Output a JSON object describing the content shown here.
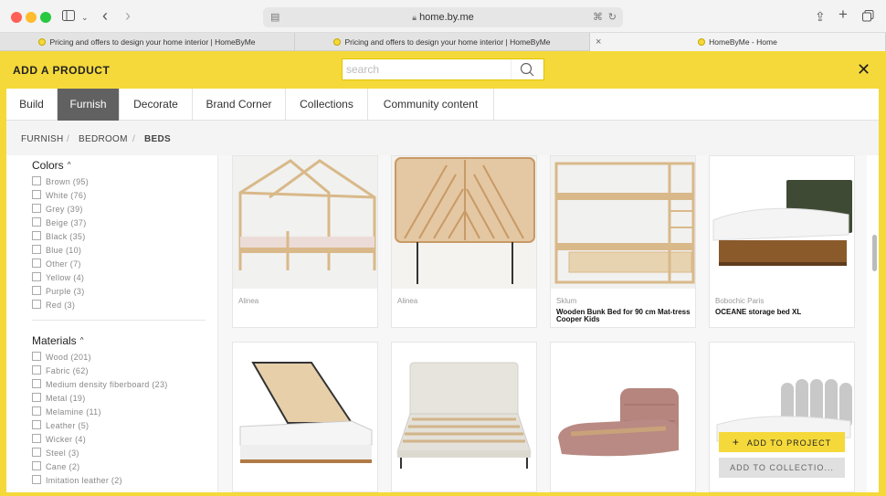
{
  "browser": {
    "url": "home.by.me",
    "tabs": [
      {
        "title": "Pricing and offers to design your home interior | HomeByMe"
      },
      {
        "title": "Pricing and offers to design your home interior | HomeByMe"
      },
      {
        "title": "HomeByMe - Home"
      }
    ]
  },
  "modal": {
    "title": "ADD A PRODUCT",
    "search_placeholder": "search"
  },
  "nav": {
    "tabs": [
      "Build",
      "Furnish",
      "Decorate",
      "Brand Corner",
      "Collections",
      "Community content"
    ],
    "active": "Furnish"
  },
  "breadcrumb": [
    "FURNISH",
    "BEDROOM",
    "BEDS"
  ],
  "filters": {
    "colors": {
      "title": "Colors",
      "options": [
        "Brown (95)",
        "White (76)",
        "Grey (39)",
        "Beige (37)",
        "Black (35)",
        "Blue (10)",
        "Other (7)",
        "Yellow (4)",
        "Purple (3)",
        "Red (3)"
      ]
    },
    "materials": {
      "title": "Materials",
      "options": [
        "Wood (201)",
        "Fabric (62)",
        "Medium density fiberboard (23)",
        "Metal (19)",
        "Melamine (11)",
        "Leather (5)",
        "Wicker (4)",
        "Steel (3)",
        "Cane (2)",
        "Imitation leather (2)"
      ]
    }
  },
  "products": [
    {
      "brand": "Alinea",
      "name": "",
      "icon": "house-bed-icon"
    },
    {
      "brand": "Alinea",
      "name": "",
      "icon": "headboard-icon"
    },
    {
      "brand": "Sklum",
      "name": "Wooden Bunk Bed for 90 cm Mat-tress Cooper Kids",
      "icon": "bunk-bed-icon"
    },
    {
      "brand": "Bobochic Paris",
      "name": "OCEANE storage bed XL",
      "icon": "storage-bed-icon"
    },
    {
      "icon": "lift-storage-bed-icon"
    },
    {
      "icon": "upholstered-bed-icon"
    },
    {
      "icon": "pink-bed-icon"
    },
    {
      "icon": "scalloped-headboard-bed-icon"
    }
  ],
  "actions": {
    "add_to_project": "ADD TO PROJECT",
    "add_to_collection": "ADD TO COLLECTIO..."
  },
  "colors": {
    "accent": "#f5d93a",
    "active_tab": "#616161"
  }
}
